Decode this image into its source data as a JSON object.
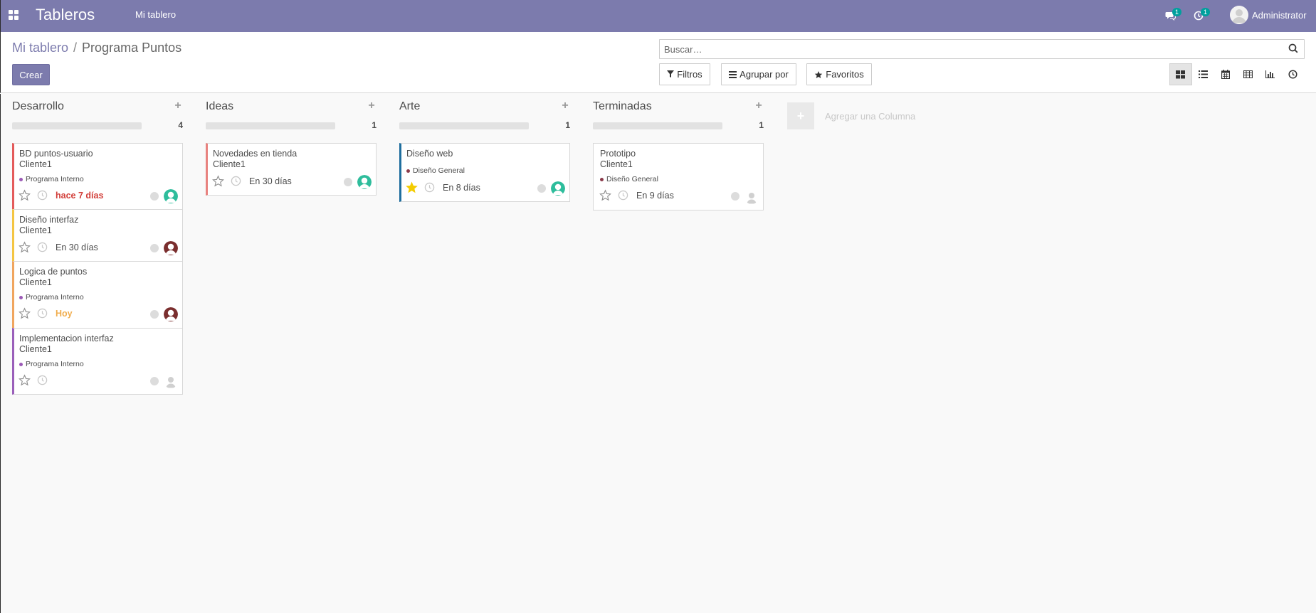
{
  "navbar": {
    "app_title": "Tableros",
    "menu_item": "Mi tablero",
    "messages_badge": "1",
    "activities_badge": "1",
    "user_name": "Administrator"
  },
  "control_panel": {
    "breadcrumb_parent": "Mi tablero",
    "breadcrumb_separator": "/",
    "breadcrumb_current": "Programa Puntos",
    "create_label": "Crear",
    "search_placeholder": "Buscar…",
    "filters_label": "Filtros",
    "group_by_label": "Agrupar por",
    "favorites_label": "Favoritos",
    "views": [
      "kanban-icon",
      "list-icon",
      "calendar-icon",
      "pivot-icon",
      "graph-icon",
      "activity-icon"
    ]
  },
  "kanban": {
    "add_column_label": "Agregar una Columna",
    "columns": [
      {
        "title": "Desarrollo",
        "count": "4",
        "cards": [
          {
            "title": "BD puntos-usuario",
            "client": "Cliente1",
            "tag": "Programa Interno",
            "tag_color": "#9b59b6",
            "deadline": "hace 7 días",
            "deadline_style": "overdue",
            "starred": false,
            "stripe": "#e45b5b",
            "avatar": "teal"
          },
          {
            "title": "Diseño interfaz",
            "client": "Cliente1",
            "tag": "",
            "deadline": "En 30 días",
            "deadline_style": "normal",
            "starred": false,
            "stripe": "#f4c542",
            "avatar": "brown"
          },
          {
            "title": "Logica de puntos",
            "client": "Cliente1",
            "tag": "Programa Interno",
            "tag_color": "#9b59b6",
            "deadline": "Hoy",
            "deadline_style": "today",
            "starred": false,
            "stripe": "#f0a55e",
            "avatar": "brown"
          },
          {
            "title": "Implementacion interfaz",
            "client": "Cliente1",
            "tag": "Programa Interno",
            "tag_color": "#9b59b6",
            "deadline": "",
            "deadline_style": "normal",
            "starred": false,
            "stripe": "#9a5fba",
            "avatar": "placeholder"
          }
        ]
      },
      {
        "title": "Ideas",
        "count": "1",
        "cards": [
          {
            "title": "Novedades en tienda",
            "client": "Cliente1",
            "tag": "",
            "deadline": "En 30 días",
            "deadline_style": "normal",
            "starred": false,
            "stripe": "#e8827f",
            "avatar": "teal"
          }
        ]
      },
      {
        "title": "Arte",
        "count": "1",
        "cards": [
          {
            "title": "Diseño web",
            "client": "",
            "tag": "Diseño General",
            "tag_color": "#8b3a4a",
            "deadline": "En 8 días",
            "deadline_style": "normal",
            "starred": true,
            "stripe": "#1f6e9e",
            "avatar": "teal"
          }
        ]
      },
      {
        "title": "Terminadas",
        "count": "1",
        "cards": [
          {
            "title": "Prototipo",
            "client": "Cliente1",
            "tag": "Diseño General",
            "tag_color": "#8b3a4a",
            "deadline": "En 9 días",
            "deadline_style": "normal",
            "starred": false,
            "stripe": "#d8d8d8",
            "avatar": "placeholder"
          }
        ]
      }
    ]
  },
  "colors": {
    "brand": "#7c7bad",
    "teal_badge": "#00a09d",
    "overdue": "#d23f3a",
    "today": "#f0ad4e",
    "star_active": "#f3cc00"
  }
}
